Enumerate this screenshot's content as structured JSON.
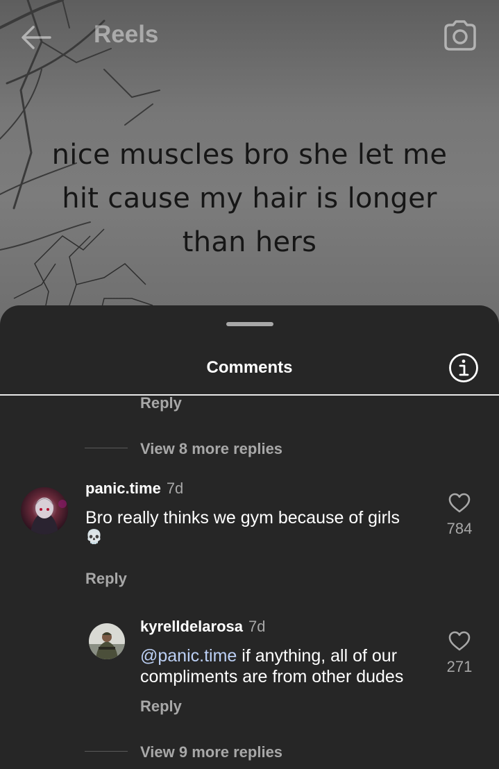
{
  "header": {
    "title": "Reels",
    "back_icon": "back-arrow-icon",
    "camera_icon": "camera-icon"
  },
  "reel": {
    "caption_lines": [
      "nice muscles bro she let me",
      "hit cause my hair is longer",
      "than hers"
    ]
  },
  "comments_sheet": {
    "title": "Comments",
    "info_icon": "info-icon",
    "top_partial": {
      "reply_label": "Reply",
      "view_more": "View 8 more replies"
    },
    "comment": {
      "username": "panic.time",
      "time": "7d",
      "text": "Bro really thinks we gym because of girls",
      "emoji": "💀",
      "likes": "784",
      "reply_label": "Reply"
    },
    "reply": {
      "username": "kyrelldelarosa",
      "time": "7d",
      "mention": "@panic.time",
      "text_line1": " if anything, all of our",
      "text_line2": "compliments are from other dudes",
      "likes": "271",
      "reply_label": "Reply"
    },
    "bottom_view_more": "View 9 more replies"
  },
  "colors": {
    "sheet_bg": "#262626",
    "muted_text": "#a8a8a8",
    "mention": "#bcd0f5"
  }
}
